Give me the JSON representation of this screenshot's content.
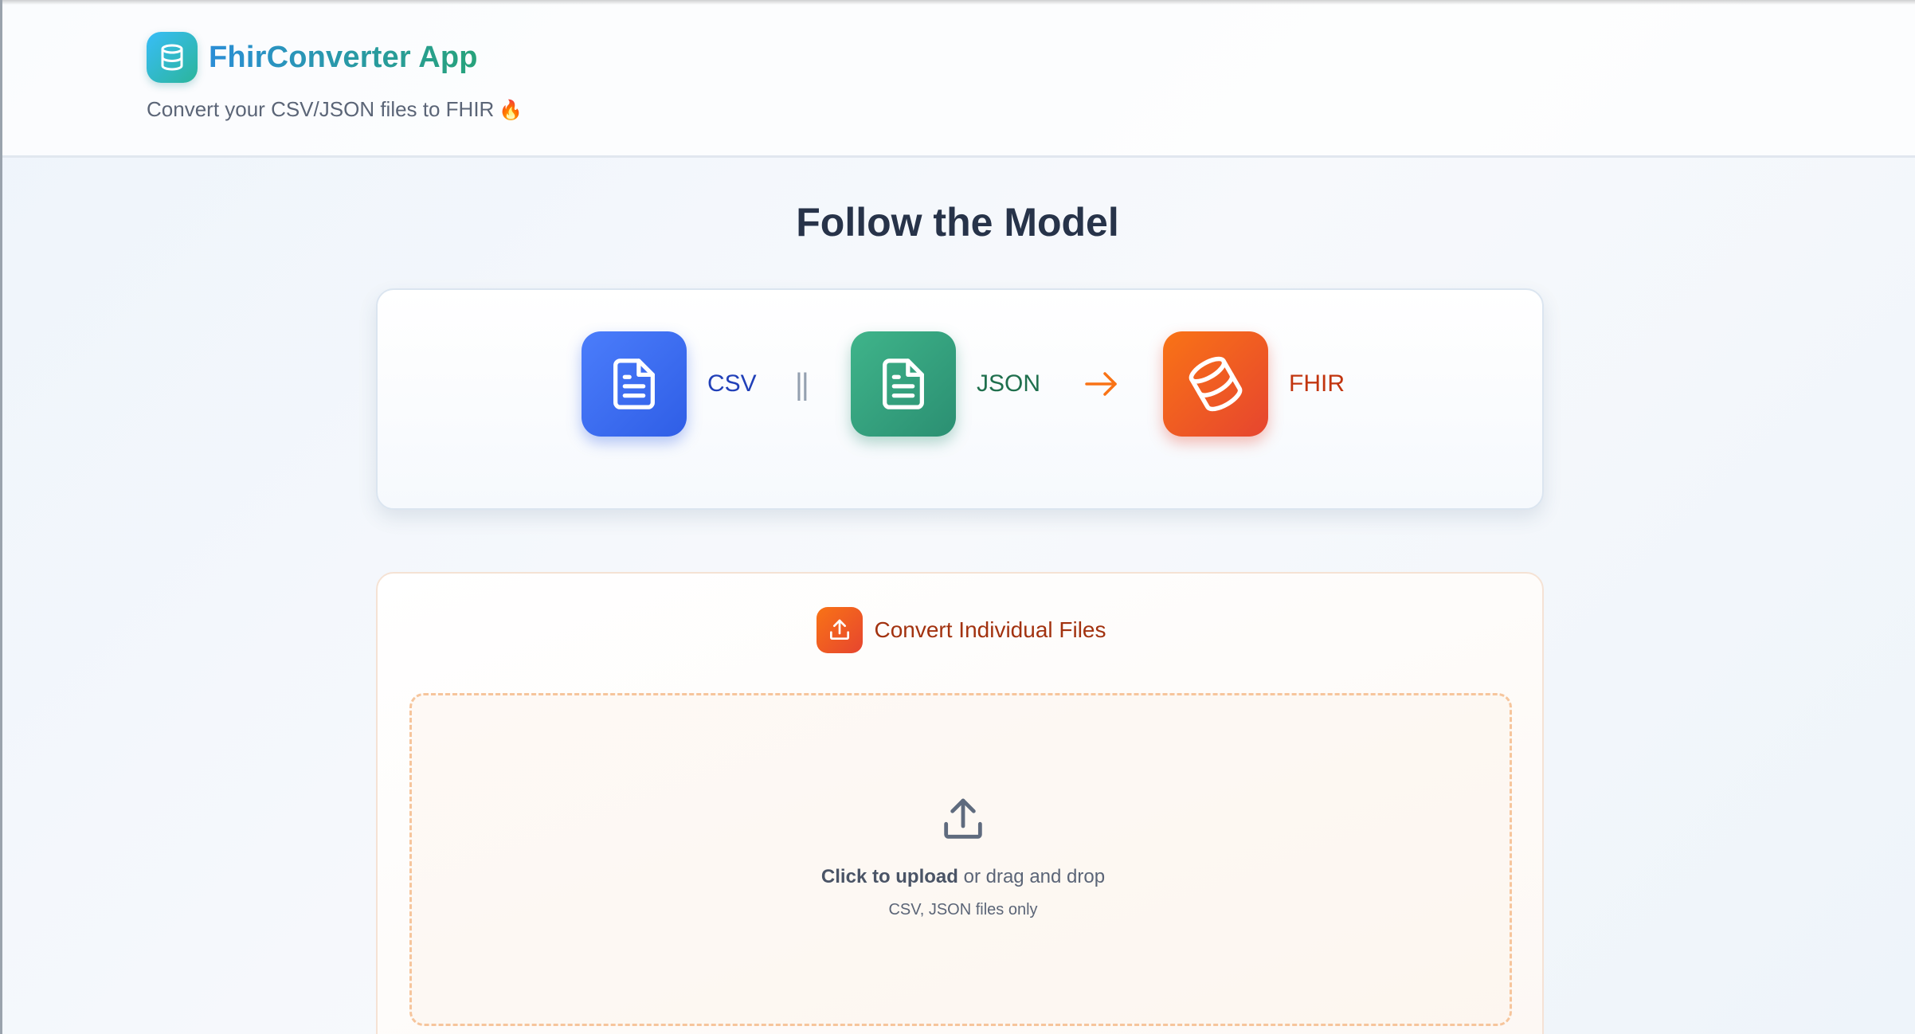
{
  "app": {
    "title": "FhirConverter App",
    "subtitle": "Convert your CSV/JSON files to FHIR",
    "subtitle_emoji": "🔥",
    "logo_icon": "database-icon"
  },
  "main": {
    "heading": "Follow the Model",
    "model": {
      "steps": [
        {
          "label": "CSV",
          "icon": "file-text-icon",
          "color": "#2f5ee6"
        },
        {
          "label": "JSON",
          "icon": "file-text-icon",
          "color": "#2b8f72"
        },
        {
          "label": "FHIR",
          "icon": "database-icon",
          "color": "#e6452f"
        }
      ],
      "separator": "||",
      "arrow_icon": "arrow-right-icon"
    },
    "upload": {
      "title": "Convert Individual Files",
      "icon": "upload-icon",
      "drop_strong": "Click to upload",
      "drop_rest": " or drag and drop",
      "drop_hint": "CSV, JSON files only"
    }
  },
  "colors": {
    "accent_blue": "#2f5ee6",
    "accent_green": "#2b8f72",
    "accent_orange": "#f97316",
    "heading": "#273349"
  }
}
